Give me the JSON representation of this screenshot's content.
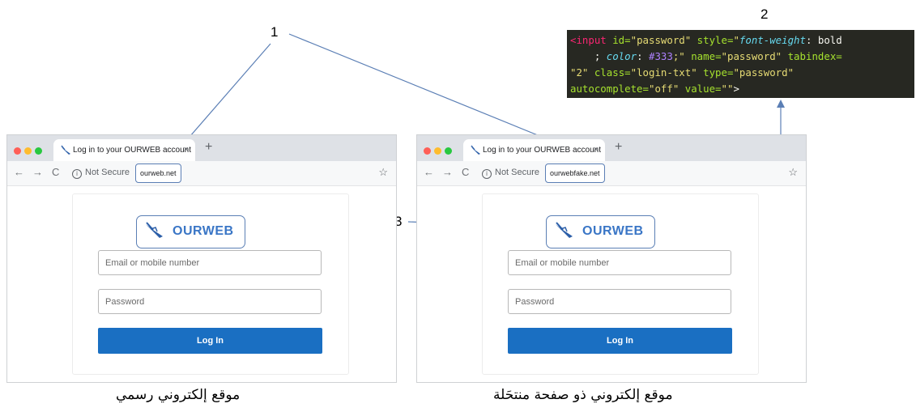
{
  "callouts": {
    "one": "1",
    "two": "2",
    "three": "3"
  },
  "code_snippet": {
    "tag_open": "<input",
    "id_attr": " id=",
    "id_val": "\"password\"",
    "style_attr": " style=",
    "style_q1": "\"",
    "style_prop1": "font-weight",
    "style_colon1": ": bold",
    "style_line2a": "    ; ",
    "style_prop2": "color",
    "style_colon2": ": ",
    "style_num": "#333",
    "style_end": ";\"",
    "name_attr": " name=",
    "name_val": "\"password\"",
    "tabindex_attr": " tabindex=",
    "tabindex_val": "\"2\"",
    "class_attr": " class=",
    "class_val": "\"login-txt\"",
    "type_attr": " type=",
    "type_val": "\"password\"",
    "autocomplete_attr": "autocomplete=",
    "autocomplete_val": "\"off\"",
    "value_attr": " value=",
    "value_val": "\"\"",
    "tag_close": ">"
  },
  "browsers": {
    "left": {
      "tab_title": "Log in to your OURWEB account",
      "tab_close": "×",
      "new_tab": "+",
      "nav_back": "←",
      "nav_forward": "→",
      "nav_reload": "C",
      "info_icon": "i",
      "not_secure": "Not Secure",
      "url": "ourweb.net",
      "bookmark": "☆",
      "logo_text": "OURWEB",
      "email_placeholder": "Email or mobile number",
      "password_placeholder": "Password",
      "login_button": "Log In",
      "caption": "موقع إلكتروني رسمي"
    },
    "right": {
      "tab_title": "Log in to your OURWEB account",
      "tab_close": "×",
      "new_tab": "+",
      "nav_back": "←",
      "nav_forward": "→",
      "nav_reload": "C",
      "info_icon": "i",
      "not_secure": "Not Secure",
      "url": "ourwebfake.net",
      "bookmark": "☆",
      "logo_text": "OURWEB",
      "email_placeholder": "Email or mobile number",
      "password_placeholder": "Password",
      "login_button": "Log In",
      "caption": "موقع إلكتروني ذو صفحة منتحَلة"
    }
  },
  "colors": {
    "accent": "#1a6fc2",
    "callout_line": "#5b7fb5",
    "code_bg": "#272822"
  },
  "icons": {
    "tab_favicon": "feather-icon",
    "logo": "feather-icon"
  }
}
